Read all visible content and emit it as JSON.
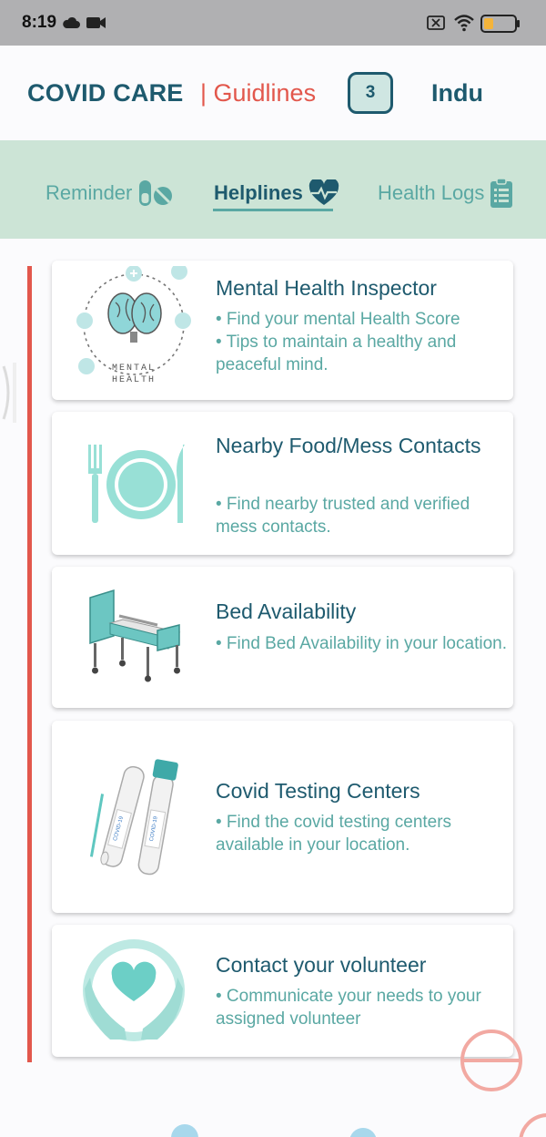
{
  "status_bar": {
    "time": "8:19",
    "icons": [
      "cloud-icon",
      "video-camera-icon",
      "no-sim-icon",
      "wifi-icon",
      "battery-icon"
    ]
  },
  "header": {
    "brand": "COVID CARE",
    "guidelines_link": "| Guidlines",
    "badge_count": "3",
    "user_name": "Indu"
  },
  "tabs": [
    {
      "label": "Reminder",
      "icon": "pills-icon",
      "active": false
    },
    {
      "label": "Helplines",
      "icon": "heartbeat-icon",
      "active": true
    },
    {
      "label": "Health Logs",
      "icon": "clipboard-icon",
      "active": false
    }
  ],
  "cards": [
    {
      "title": "Mental Health Inspector",
      "desc": "• Find your mental Health Score\n• Tips to maintain a healthy and peaceful mind.",
      "image_text": "MENTAL\nHEALTH"
    },
    {
      "title": "Nearby Food/Mess Contacts",
      "desc": "• Find nearby trusted and verified mess contacts."
    },
    {
      "title": "Bed Availability",
      "desc": "• Find Bed Availability in your location."
    },
    {
      "title": "Covid Testing Centers",
      "desc": "• Find the covid testing centers available in your location."
    },
    {
      "title": "Contact your volunteer",
      "desc": "• Communicate your needs to your assigned volunteer"
    }
  ],
  "colors": {
    "brand": "#1e5a6e",
    "accent_red": "#e2574c",
    "teal": "#5aa8a3",
    "tab_bg": "#cce4d6",
    "status_bg": "#b0b0b2"
  }
}
